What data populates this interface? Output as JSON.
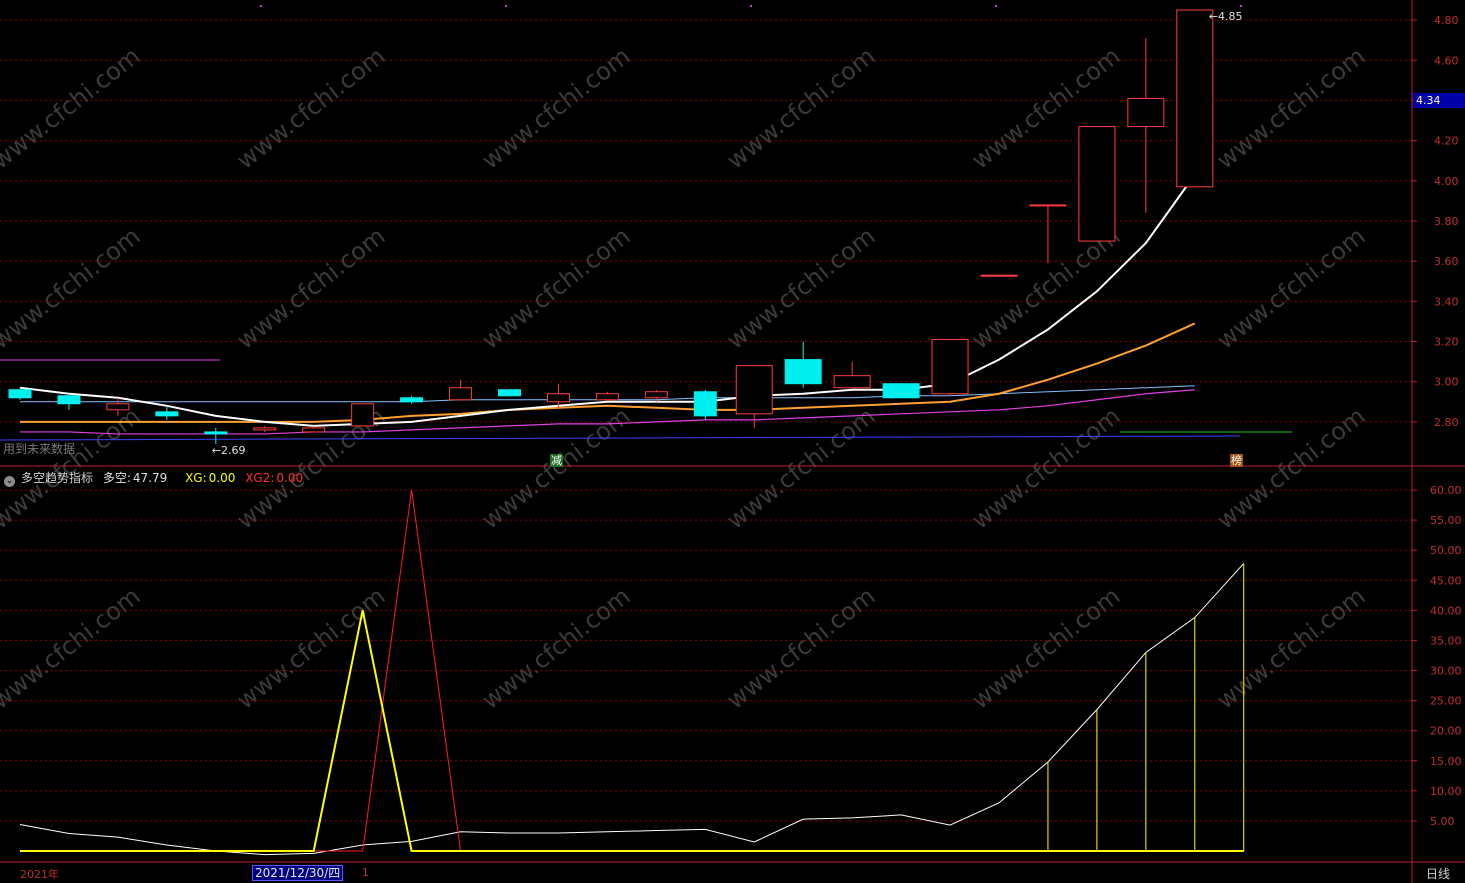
{
  "colors": {
    "up": "#ff3c3c",
    "down": "#00f0f0",
    "ma5": "#ffffff",
    "ma10": "#ffa030",
    "ma20": "#e040e0",
    "ma30": "#80c0ff",
    "ma60": "#4040ff",
    "base": "#20c020",
    "dk": "#ffffff",
    "xg": "#ffff00",
    "xg2": "#ff2020",
    "grid": "#8b0000",
    "axis": "#c02020"
  },
  "chart_data": [
    {
      "type": "candlestick",
      "title": "",
      "ylim": [
        2.66,
        4.88
      ],
      "y_ticks": [
        2.8,
        3.0,
        3.2,
        3.4,
        3.6,
        3.8,
        4.0,
        4.2,
        4.4,
        4.6,
        4.8
      ],
      "y_tick_labels": [
        "2.80",
        "3.00",
        "3.20",
        "3.40",
        "3.60",
        "3.80",
        "4.00",
        "4.20",
        "4.40",
        "4.60",
        "4.80"
      ],
      "candles": [
        {
          "o": 2.96,
          "c": 2.92,
          "h": 2.97,
          "l": 2.91
        },
        {
          "o": 2.93,
          "c": 2.89,
          "h": 2.94,
          "l": 2.86
        },
        {
          "o": 2.86,
          "c": 2.89,
          "h": 2.92,
          "l": 2.83
        },
        {
          "o": 2.85,
          "c": 2.83,
          "h": 2.88,
          "l": 2.81
        },
        {
          "o": 2.75,
          "c": 2.74,
          "h": 2.77,
          "l": 2.69
        },
        {
          "o": 2.76,
          "c": 2.77,
          "h": 2.78,
          "l": 2.75
        },
        {
          "o": 2.75,
          "c": 2.77,
          "h": 2.78,
          "l": 2.75
        },
        {
          "o": 2.78,
          "c": 2.89,
          "h": 2.89,
          "l": 2.78
        },
        {
          "o": 2.92,
          "c": 2.9,
          "h": 2.93,
          "l": 2.89
        },
        {
          "o": 2.91,
          "c": 2.97,
          "h": 3.01,
          "l": 2.91
        },
        {
          "o": 2.96,
          "c": 2.93,
          "h": 2.95,
          "l": 2.93
        },
        {
          "o": 2.9,
          "c": 2.94,
          "h": 2.99,
          "l": 2.87
        },
        {
          "o": 2.91,
          "c": 2.94,
          "h": 2.95,
          "l": 2.91
        },
        {
          "o": 2.92,
          "c": 2.95,
          "h": 2.96,
          "l": 2.9
        },
        {
          "o": 2.95,
          "c": 2.83,
          "h": 2.96,
          "l": 2.81
        },
        {
          "o": 2.84,
          "c": 3.08,
          "h": 3.08,
          "l": 2.77
        },
        {
          "o": 3.11,
          "c": 2.99,
          "h": 3.2,
          "l": 2.97
        },
        {
          "o": 2.97,
          "c": 3.03,
          "h": 3.1,
          "l": 2.97
        },
        {
          "o": 2.99,
          "c": 2.92,
          "h": 2.98,
          "l": 2.92
        },
        {
          "o": 2.94,
          "c": 3.21,
          "h": 3.21,
          "l": 2.93
        },
        {
          "o": 3.53,
          "c": 3.53,
          "h": 3.53,
          "l": 3.53
        },
        {
          "o": 3.88,
          "c": 3.88,
          "h": 3.88,
          "l": 3.59
        },
        {
          "o": 3.7,
          "c": 4.27,
          "h": 4.27,
          "l": 3.7
        },
        {
          "o": 4.27,
          "c": 4.41,
          "h": 4.71,
          "l": 3.84
        },
        {
          "o": 3.97,
          "c": 4.85,
          "h": 4.85,
          "l": 3.97
        }
      ],
      "ma5": [
        2.97,
        2.94,
        2.92,
        2.88,
        2.83,
        2.8,
        2.78,
        2.79,
        2.8,
        2.83,
        2.86,
        2.88,
        2.9,
        2.9,
        2.9,
        2.93,
        2.94,
        2.96,
        2.96,
        2.99,
        3.11,
        3.26,
        3.45,
        3.69,
        4.03
      ],
      "ma10": [
        2.8,
        2.8,
        2.8,
        2.8,
        2.8,
        2.8,
        2.8,
        2.81,
        2.83,
        2.84,
        2.86,
        2.87,
        2.88,
        2.87,
        2.86,
        2.86,
        2.87,
        2.88,
        2.89,
        2.9,
        2.94,
        3.01,
        3.09,
        3.18,
        3.29
      ],
      "ma20": [
        2.75,
        2.75,
        2.74,
        2.74,
        2.74,
        2.74,
        2.75,
        2.75,
        2.76,
        2.77,
        2.78,
        2.79,
        2.79,
        2.8,
        2.81,
        2.81,
        2.82,
        2.83,
        2.84,
        2.85,
        2.86,
        2.88,
        2.91,
        2.94,
        2.96
      ],
      "ma30": [
        2.9,
        2.9,
        2.9,
        2.9,
        2.9,
        2.9,
        2.9,
        2.9,
        2.9,
        2.91,
        2.91,
        2.91,
        2.91,
        2.91,
        2.92,
        2.92,
        2.92,
        2.92,
        2.93,
        2.93,
        2.94,
        2.95,
        2.96,
        2.97,
        2.98
      ],
      "ma60": [
        2.69,
        2.69,
        2.69,
        2.69,
        2.69,
        2.69,
        2.69,
        2.69,
        2.7,
        2.7,
        2.7,
        2.7,
        2.7,
        2.7,
        2.7,
        2.7,
        2.7,
        2.7,
        2.71,
        2.71,
        2.71,
        2.71,
        2.72,
        2.72,
        2.73
      ],
      "high_label": "4.85",
      "low_label": "2.69",
      "last_price": "4.34",
      "markers": [
        "减",
        "榜"
      ],
      "note": "用到未来数据"
    },
    {
      "type": "line",
      "title": "多空趋势指标",
      "ylim": [
        0,
        62
      ],
      "y_ticks": [
        5,
        10,
        15,
        20,
        25,
        30,
        35,
        40,
        45,
        50,
        55,
        60
      ],
      "y_tick_labels": [
        "5.00",
        "10.00",
        "15.00",
        "20.00",
        "25.00",
        "30.00",
        "35.00",
        "40.00",
        "45.00",
        "50.00",
        "55.00",
        "60.00"
      ],
      "series": [
        {
          "name": "多空",
          "values": [
            4.4,
            2.9,
            2.3,
            1.0,
            0.0,
            -0.6,
            -0.4,
            1.0,
            1.6,
            3.2,
            3.0,
            3.0,
            3.2,
            3.4,
            3.6,
            1.5,
            5.3,
            5.5,
            6.0,
            4.3,
            8.0,
            14.8,
            23.5,
            33.0,
            38.8,
            47.79
          ]
        },
        {
          "name": "XG",
          "values": [
            0,
            0,
            0,
            0,
            0,
            0,
            0,
            40,
            0,
            0,
            0,
            0,
            0,
            0,
            0,
            0,
            0,
            0,
            0,
            0,
            0,
            0,
            0,
            0,
            0,
            0
          ]
        },
        {
          "name": "XG2",
          "values": [
            0,
            0,
            0,
            0,
            0,
            0,
            0,
            0,
            60,
            0,
            0,
            0,
            0,
            0,
            0,
            0,
            0,
            0,
            0,
            0,
            0,
            0,
            0,
            0,
            0,
            0
          ]
        }
      ],
      "legend": {
        "name": "多空趋势指标",
        "dk_label": "多空:",
        "dk_value": "47.79",
        "xg_label": "XG:",
        "xg_value": "0.00",
        "xg2_label": "XG2:",
        "xg2_value": "0.00"
      }
    }
  ],
  "footer": {
    "year": "2021年",
    "date": "2021/12/30/四",
    "cursor_mark": "1",
    "period": "日线"
  },
  "watermark": "www.cfchi.com"
}
